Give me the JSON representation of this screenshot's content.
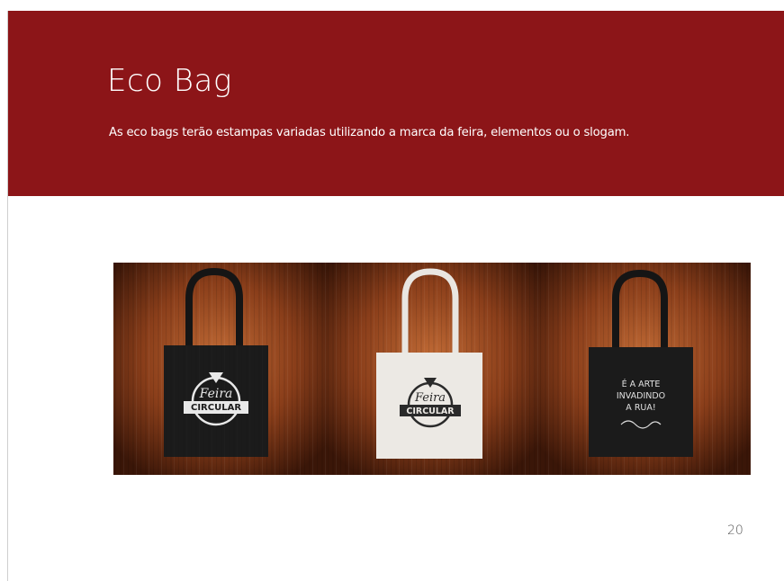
{
  "slide": {
    "title": "Eco Bag",
    "description": "As eco bags terão estampas variadas utilizando a marca da feira, elementos ou o slogam.",
    "page_number": "20",
    "colors": {
      "header": "#8c1518",
      "wood_dark": "#3a1608",
      "wood_light": "#b25a2c"
    }
  },
  "image": {
    "bags": [
      {
        "color": "black",
        "print": "logo",
        "logo_top": "Feira",
        "logo_bottom": "CIRCULAR"
      },
      {
        "color": "white",
        "print": "logo",
        "logo_top": "Feira",
        "logo_bottom": "CIRCULAR"
      },
      {
        "color": "black",
        "print": "slogan",
        "slogan_lines": [
          "É A ARTE",
          "INVADINDO",
          "A RUA!"
        ]
      }
    ]
  }
}
